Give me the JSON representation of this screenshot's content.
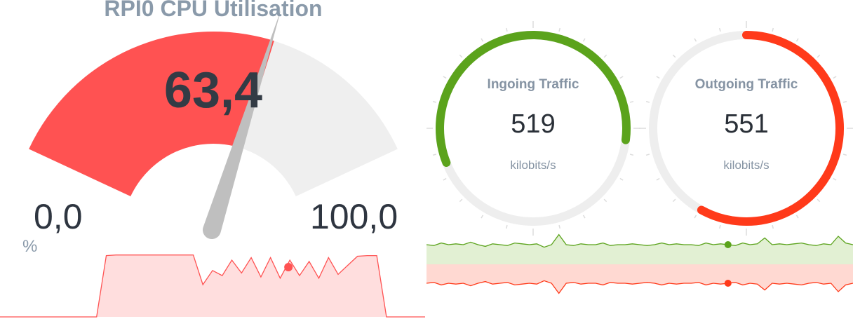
{
  "cpu_gauge": {
    "title": "RPI0 CPU Utilisation",
    "value": "63,4",
    "value_fraction": 0.634,
    "min_label": "0,0",
    "max_label": "100,0",
    "unit": "%",
    "fill_color": "#ff5252",
    "track_color": "#efefef",
    "needle_color": "#bfbfbf",
    "sparkline": [
      0,
      0,
      0,
      0,
      0,
      0,
      0,
      0,
      0,
      0,
      0,
      95,
      96,
      96,
      96,
      96,
      96,
      96,
      96,
      96,
      96,
      50,
      72,
      64,
      88,
      68,
      92,
      62,
      92,
      60,
      88,
      64,
      86,
      60,
      92,
      66,
      80,
      94,
      95,
      95,
      0,
      0,
      0,
      0,
      0
    ]
  },
  "traffic": {
    "ingoing": {
      "label": "Ingoing Traffic",
      "value": "519",
      "unit": "kilobits/s",
      "color": "#5ba31c",
      "fill_fraction": 0.58,
      "start_fraction": 0.69,
      "sparkline": [
        50,
        49,
        52,
        50,
        51,
        50,
        53,
        50,
        48,
        51,
        50,
        49,
        52,
        51,
        50,
        51,
        47,
        50,
        62,
        50,
        49,
        51,
        50,
        50,
        52,
        49,
        50,
        50,
        51,
        50,
        49,
        50,
        52,
        50,
        51,
        50,
        50,
        49,
        52,
        50,
        51,
        50,
        49,
        52,
        50,
        51,
        58,
        50,
        51,
        50,
        51,
        52,
        50,
        49,
        51,
        50,
        60,
        52,
        50
      ]
    },
    "outgoing": {
      "label": "Outgoing Traffic",
      "value": "551",
      "unit": "kilobits/s",
      "color": "#ff3a1a",
      "fill_fraction": 0.58,
      "start_fraction": 0.0,
      "sparkline": [
        50,
        51,
        48,
        50,
        49,
        50,
        47,
        50,
        52,
        49,
        50,
        51,
        48,
        49,
        50,
        49,
        53,
        50,
        38,
        50,
        51,
        49,
        50,
        50,
        48,
        51,
        50,
        50,
        49,
        50,
        51,
        50,
        48,
        50,
        49,
        50,
        50,
        51,
        48,
        50,
        49,
        50,
        51,
        48,
        50,
        49,
        42,
        50,
        49,
        50,
        49,
        48,
        50,
        51,
        49,
        50,
        40,
        48,
        50
      ]
    }
  }
}
